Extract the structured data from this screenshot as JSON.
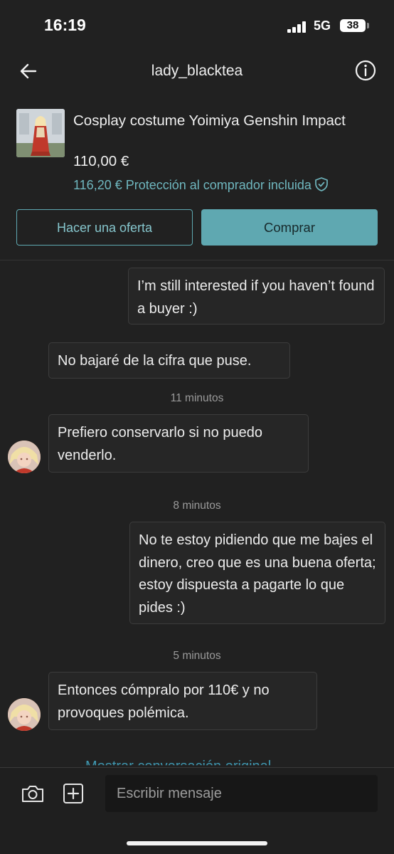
{
  "status_bar": {
    "time": "16:19",
    "network": "5G",
    "battery": "38"
  },
  "nav": {
    "title": "lady_blacktea",
    "back_icon": "arrow-left-icon",
    "info_icon": "info-circle-icon"
  },
  "product": {
    "title": "Cosplay costume Yoimiya Genshin Impact",
    "price": "110,00 €",
    "protection": "116,20 € Protección al comprador incluida",
    "protection_icon": "shield-check-icon"
  },
  "actions": {
    "offer_label": "Hacer una oferta",
    "buy_label": "Comprar"
  },
  "messages": [
    {
      "side": "right",
      "text": "I’m still interested if you haven’t found a buyer :)"
    },
    {
      "side": "left",
      "text": "No bajaré de la cifra que puse."
    },
    {
      "type": "timestamp",
      "text": "11 minutos"
    },
    {
      "side": "left",
      "text": "Prefiero conservarlo si no puedo venderlo.",
      "avatar": true
    },
    {
      "type": "timestamp",
      "text": "8 minutos"
    },
    {
      "side": "right",
      "text": "No te estoy pidiendo que me bajes el dinero, creo que es una buena oferta; estoy dispuesta a pagarte lo que pides :)"
    },
    {
      "type": "timestamp",
      "text": "5 minutos"
    },
    {
      "side": "left",
      "text": "Entonces cómpralo por 110€ y no provoques polémica.",
      "avatar": true
    }
  ],
  "footer": {
    "original_link": "Mostrar conversación original",
    "input_placeholder": "Escribir mensaje",
    "camera_icon": "camera-icon",
    "add_icon": "plus-square-icon"
  },
  "colors": {
    "background": "#212121",
    "accent": "#5fa8b1",
    "bubble": "#262626"
  }
}
